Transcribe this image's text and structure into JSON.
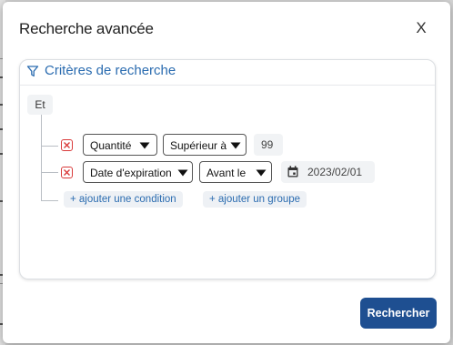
{
  "dialog": {
    "title": "Recherche avancée",
    "close_label": "X"
  },
  "criteria": {
    "title": "Critères de recherche",
    "group_operator": "Et",
    "conditions": [
      {
        "field": "Quantité",
        "operator": "Supérieur à",
        "value": "99"
      },
      {
        "field": "Date d'expiration",
        "operator": "Avant le",
        "value": "2023/02/01"
      }
    ],
    "add_condition_label": "+ ajouter une condition",
    "add_group_label": "+ ajouter un groupe"
  },
  "footer": {
    "search_label": "Rechercher"
  },
  "colors": {
    "primary": "#1e4f91",
    "link": "#2b6cb0",
    "delete": "#d93a3a"
  },
  "icons": [
    "filter-icon",
    "delete-condition-icon",
    "chevron-down-icon",
    "calendar-icon"
  ]
}
